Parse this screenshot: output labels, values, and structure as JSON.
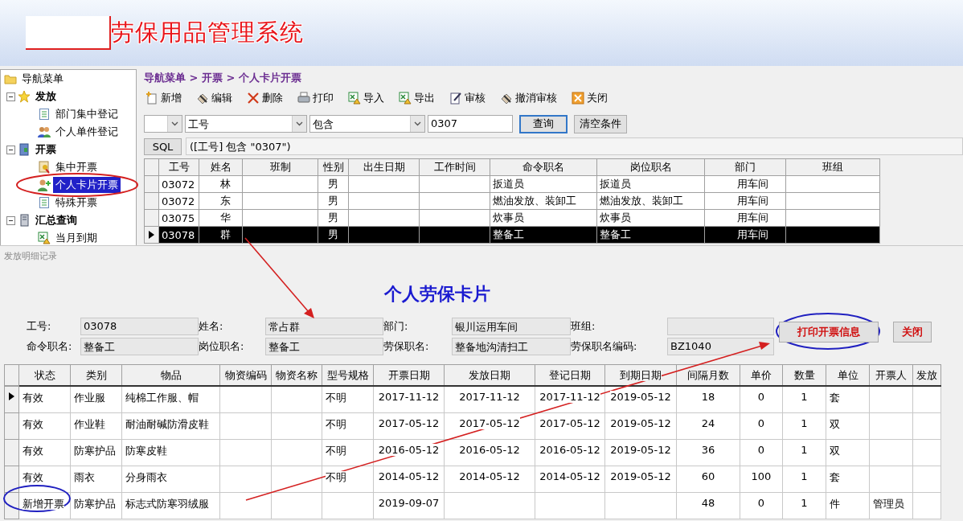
{
  "header": {
    "title": "劳保用品管理系统"
  },
  "sidebar": {
    "items": [
      {
        "label": "导航菜单",
        "selected": false,
        "children": [
          {
            "label": "发放",
            "expanded": true,
            "selected": false,
            "children": [
              {
                "label": "部门集中登记",
                "selected": false
              },
              {
                "label": "个人单件登记",
                "selected": false
              }
            ]
          },
          {
            "label": "开票",
            "expanded": true,
            "selected": false,
            "children": [
              {
                "label": "集中开票",
                "selected": false
              },
              {
                "label": "个人卡片开票",
                "selected": true
              },
              {
                "label": "特殊开票",
                "selected": false
              }
            ]
          },
          {
            "label": "汇总查询",
            "expanded": true,
            "selected": false,
            "children": [
              {
                "label": "当月到期",
                "selected": false
              }
            ]
          }
        ]
      }
    ]
  },
  "breadcrumb": "导航菜单 > 开票 > 个人卡片开票",
  "toolbar": [
    "新增",
    "编辑",
    "删除",
    "打印",
    "导入",
    "导出",
    "审核",
    "撤消审核",
    "关闭"
  ],
  "filter": {
    "field": "工号",
    "operator": "包含",
    "value": "0307",
    "buttons": [
      "查询",
      "清空条件"
    ]
  },
  "sql": {
    "button": "SQL",
    "expression": "([工号] 包含 \"0307\")"
  },
  "employees": {
    "columns": [
      "工号",
      "姓名",
      "班制",
      "性别",
      "出生日期",
      "工作时间",
      "命令职名",
      "岗位职名",
      "部门",
      "班组"
    ],
    "rows": [
      {
        "selected": false,
        "cells": [
          "03072",
          "林",
          null,
          "男",
          null,
          null,
          "扳道员",
          "扳道员",
          "用车间",
          null
        ]
      },
      {
        "selected": false,
        "cells": [
          "03072",
          "东",
          null,
          "男",
          null,
          null,
          "燃油发放、装卸工",
          "燃油发放、装卸工",
          "用车间",
          null
        ]
      },
      {
        "selected": false,
        "cells": [
          "03075",
          "华",
          null,
          "男",
          null,
          null,
          "炊事员",
          "炊事员",
          "用车间",
          null
        ]
      },
      {
        "selected": true,
        "cells": [
          "03078",
          "群",
          null,
          "男",
          null,
          null,
          "整备工",
          "整备工",
          "用车间",
          null
        ]
      }
    ]
  },
  "dialog": {
    "title": "发放明细记录",
    "heading": "个人劳保卡片",
    "fields": [
      {
        "label": "工号:",
        "value": "03078"
      },
      {
        "label": "姓名:",
        "value": "常占群"
      },
      {
        "label": "部门:",
        "value": "银川运用车间"
      },
      {
        "label": "班组:"
      },
      {
        "label": "命令职名:",
        "value": "整备工"
      },
      {
        "label": "岗位职名:",
        "value": "整备工"
      },
      {
        "label": "劳保职名:",
        "value": "整备地沟清扫工"
      },
      {
        "label": "劳保职名编码:",
        "value": "BZ1040"
      }
    ],
    "buttons": [
      "打印开票信息",
      "关闭"
    ],
    "table": {
      "columns": [
        "状态",
        "类别",
        "物品",
        "物资编码",
        "物资名称",
        "型号规格",
        "开票日期",
        "发放日期",
        "登记日期",
        "到期日期",
        "间隔月数",
        "单价",
        "数量",
        "单位",
        "开票人",
        "发放"
      ],
      "rows": [
        {
          "selected": true,
          "cells": [
            "有效",
            "作业服",
            "纯棉工作服、帽",
            null,
            null,
            "不明",
            "2017-11-12",
            "2017-11-12",
            "2017-11-12",
            "2019-05-12",
            "18",
            "0",
            "1",
            "套",
            null,
            null
          ]
        },
        {
          "selected": false,
          "cells": [
            "有效",
            "作业鞋",
            "耐油耐碱防滑皮鞋",
            null,
            null,
            "不明",
            "2017-05-12",
            "2017-05-12",
            "2017-05-12",
            "2019-05-12",
            "24",
            "0",
            "1",
            "双",
            null,
            null
          ]
        },
        {
          "selected": false,
          "cells": [
            "有效",
            "防寒护品",
            "防寒皮鞋",
            null,
            null,
            "不明",
            "2016-05-12",
            "2016-05-12",
            "2016-05-12",
            "2019-05-12",
            "36",
            "0",
            "1",
            "双",
            null,
            null
          ]
        },
        {
          "selected": false,
          "cells": [
            "有效",
            "雨衣",
            "分身雨衣",
            null,
            null,
            "不明",
            "2014-05-12",
            "2014-05-12",
            "2014-05-12",
            "2019-05-12",
            "60",
            "100",
            "1",
            "套",
            null,
            null
          ]
        },
        {
          "selected": false,
          "cells": [
            "新增开票",
            "防寒护品",
            "标志式防寒羽绒服",
            null,
            null,
            null,
            "2019-09-07",
            null,
            null,
            null,
            "48",
            "0",
            "1",
            "件",
            "管理员",
            null
          ]
        }
      ]
    }
  }
}
